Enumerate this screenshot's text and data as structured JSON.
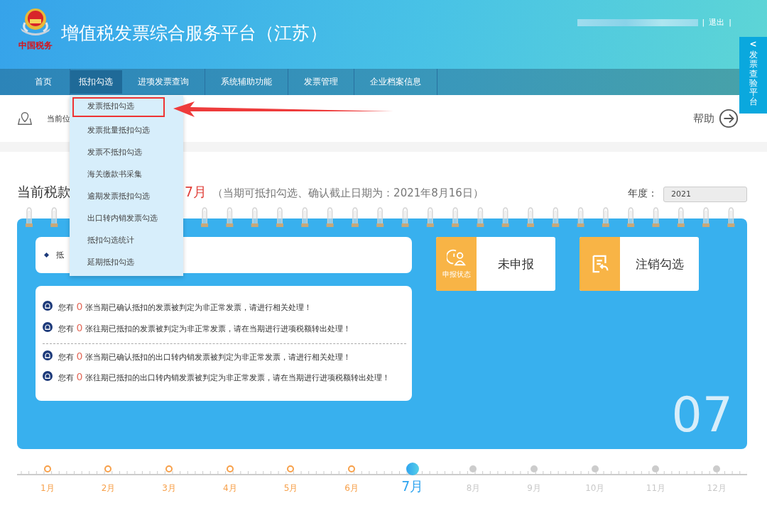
{
  "header": {
    "logo_text": "中国税务",
    "title": "增值税发票综合服务平台（江苏）",
    "logout": "退出",
    "separator": "|"
  },
  "side_tab": {
    "arrow": "<",
    "label": "发票查验平台"
  },
  "nav": [
    {
      "label": "首页",
      "selected": false
    },
    {
      "label": "抵扣勾选",
      "selected": true
    },
    {
      "label": "进项发票查询",
      "selected": false
    },
    {
      "label": "系统辅助功能",
      "selected": false
    },
    {
      "label": "发票管理",
      "selected": false
    },
    {
      "label": "企业档案信息",
      "selected": false
    }
  ],
  "dropdown": [
    {
      "label": "发票抵扣勾选",
      "selected": true
    },
    {
      "label": "发票批量抵扣勾选",
      "selected": false
    },
    {
      "label": "发票不抵扣勾选",
      "selected": false
    },
    {
      "label": "海关缴款书采集",
      "selected": false
    },
    {
      "label": "逾期发票抵扣勾选",
      "selected": false
    },
    {
      "label": "出口转内销发票勾选",
      "selected": false
    },
    {
      "label": "抵扣勾选统计",
      "selected": false
    },
    {
      "label": "延期抵扣勾选",
      "selected": false
    }
  ],
  "breadcrumb": "当前位",
  "help": "帮助",
  "period": {
    "label": "当前税款",
    "month": "7月",
    "note": "（当期可抵扣勾选、确认截止日期为：2021年8月16日）"
  },
  "year": {
    "label": "年度：",
    "value": "2021"
  },
  "summary": "抵",
  "notices": [
    [
      {
        "prefix": "您有",
        "count": "0",
        "text": "张当期已确认抵扣的发票被判定为非正常发票，请进行相关处理！"
      },
      {
        "prefix": "您有",
        "count": "0",
        "text": "张往期已抵扣的发票被判定为非正常发票，请在当期进行进项税额转出处理！"
      }
    ],
    [
      {
        "prefix": "您有",
        "count": "0",
        "text": "张当期已确认抵扣的出口转内销发票被判定为非正常发票，请进行相关处理！"
      },
      {
        "prefix": "您有",
        "count": "0",
        "text": "张往期已抵扣的出口转内销发票被判定为非正常发票，请在当期进行进项税额转出处理！"
      }
    ]
  ],
  "tiles": [
    {
      "kind": "status",
      "caption": "申报状态",
      "label": "未申报"
    },
    {
      "kind": "cancel",
      "label": "注销勾选"
    }
  ],
  "big_month": "07",
  "timeline": [
    {
      "label": "1月",
      "kind": "past",
      "selected": false
    },
    {
      "label": "2月",
      "kind": "past",
      "selected": false
    },
    {
      "label": "3月",
      "kind": "past",
      "selected": false
    },
    {
      "label": "4月",
      "kind": "past",
      "selected": false
    },
    {
      "label": "5月",
      "kind": "past",
      "selected": false
    },
    {
      "label": "6月",
      "kind": "past",
      "selected": false
    },
    {
      "label": "7月",
      "kind": "current",
      "selected": true
    },
    {
      "label": "8月",
      "kind": "future",
      "selected": false
    },
    {
      "label": "9月",
      "kind": "future",
      "selected": false
    },
    {
      "label": "10月",
      "kind": "future",
      "selected": false
    },
    {
      "label": "11月",
      "kind": "future",
      "selected": false
    },
    {
      "label": "12月",
      "kind": "future",
      "selected": false
    }
  ]
}
